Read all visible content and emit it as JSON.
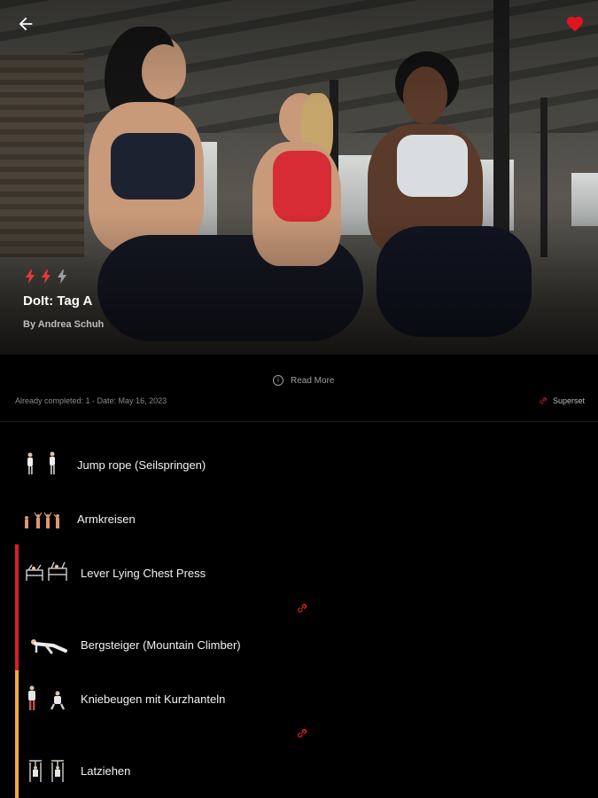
{
  "workout": {
    "title": "DoIt: Tag A",
    "author": "By Andrea Schuh",
    "difficulty_level": 2,
    "difficulty_max": 3
  },
  "header": {
    "back_icon": "arrow-left-icon",
    "favorite_icon": "heart-icon",
    "favorite_active": true
  },
  "info": {
    "read_more_label": "Read More",
    "completed_text": "Already completed: 1 - Date: May 16, 2023",
    "superset_label": "Superset"
  },
  "exercises": [
    {
      "name": "Jump rope (Seilspringen)",
      "group": null
    },
    {
      "name": "Armkreisen",
      "group": null
    },
    {
      "name": "Lever Lying Chest Press",
      "group": "red"
    },
    {
      "name": "Bergsteiger (Mountain Climber)",
      "group": "red"
    },
    {
      "name": "Kniebeugen mit Kurzhanteln",
      "group": "orange"
    },
    {
      "name": "Latziehen",
      "group": "orange"
    }
  ],
  "colors": {
    "accent_red": "#d81f26",
    "accent_orange": "#f2a93b",
    "difficulty_active": "#e53935",
    "difficulty_inactive": "#9e9e9e",
    "background": "#000000"
  }
}
